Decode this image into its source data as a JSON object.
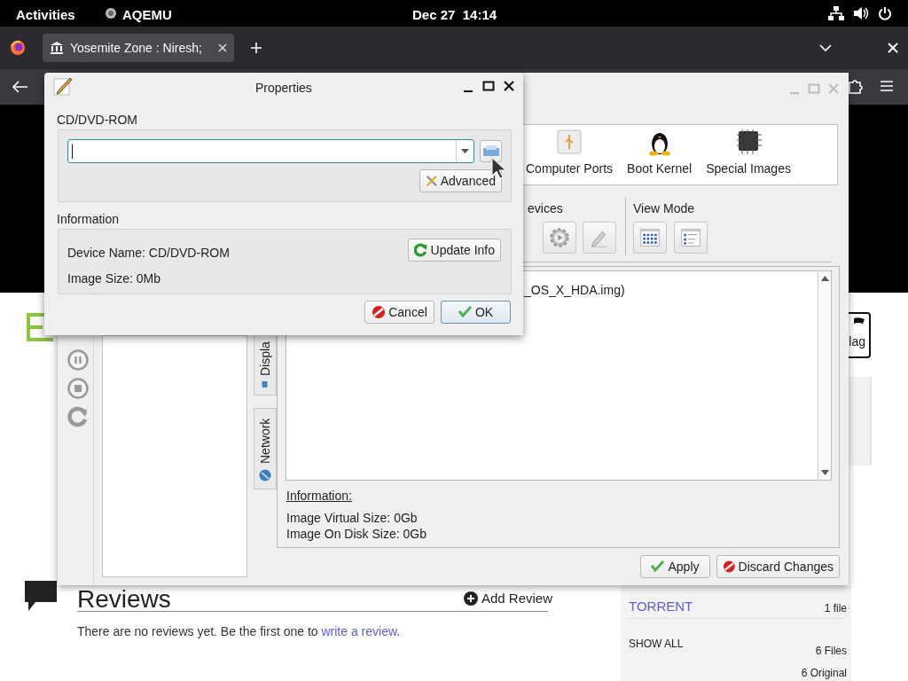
{
  "top_bar": {
    "activities": "Activities",
    "app_name": "AQEMU",
    "clock": "Dec 27  14:14"
  },
  "browser": {
    "tabs": [
      {
        "label": "Yosemite Zone : Niresh;",
        "selected": true
      }
    ]
  },
  "web_page": {
    "flag_button": "lag",
    "reviews": {
      "title": "Reviews",
      "add_review": "Add Review",
      "message": "There are no reviews yet. Be the first one to ",
      "link": "write a review",
      "message_end": "."
    },
    "files": [
      {
        "label": "TORRENT",
        "count": "1 file",
        "kind": "link"
      },
      {
        "label": "SHOW ALL",
        "count": "6 Files",
        "kind": "plain"
      },
      {
        "count": "6 Original",
        "kind": "plain"
      }
    ]
  },
  "aqemu": {
    "active": false,
    "toolbar": [
      {
        "label": "Computer Ports",
        "kind": "usb"
      },
      {
        "label": "Boot Kernel",
        "kind": "penguin"
      },
      {
        "label": "Special Images",
        "kind": "chip"
      }
    ],
    "devices_label": "evices",
    "view_mode_label": "View Mode",
    "device_details": "_OS_X_HDA.img)",
    "side_tabs": [
      {
        "label": "Displa",
        "kind": "display"
      },
      {
        "label": "Network",
        "kind": "network"
      }
    ],
    "information_title": "Information:",
    "information_lines": [
      "Image Virtual Size: 0Gb",
      "Image On Disk Size: 0Gb"
    ],
    "buttons": [
      {
        "label": "Apply",
        "kind": "apply"
      },
      {
        "label": "Discard Changes",
        "kind": "discard"
      }
    ]
  },
  "dialog": {
    "title": "Properties",
    "device_group": "CD/DVD-ROM",
    "image_field": {
      "focused": true
    },
    "advanced_button": "Advanced",
    "information_group": "Information",
    "device_name": "Device Name: CD/DVD-ROM",
    "update_button": "Update Info",
    "image_size": "Image Size: 0Mb",
    "buttons": [
      {
        "label": "Cancel",
        "kind": "cancel",
        "default": false
      },
      {
        "label": "OK",
        "kind": "ok",
        "default": true
      }
    ]
  }
}
